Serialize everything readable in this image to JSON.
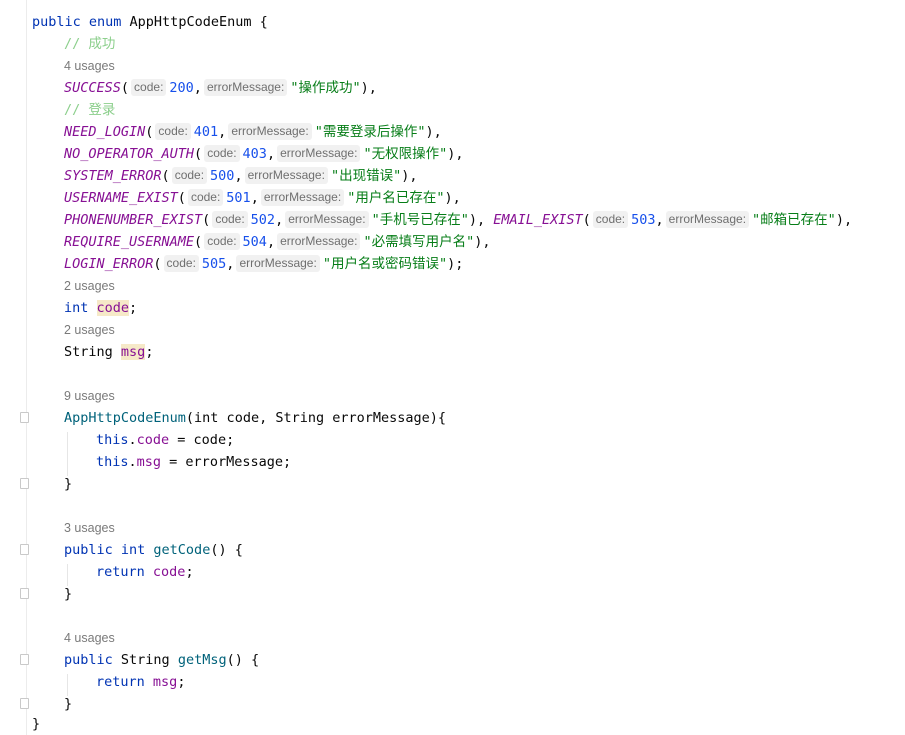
{
  "code": {
    "l1": {
      "kw": "public enum",
      "name": "AppHttpCodeEnum",
      "brace": " {"
    },
    "c_success": "// 成功",
    "u_success": "4 usages",
    "success": {
      "name": "SUCCESS",
      "code": "200",
      "msg": "\"操作成功\""
    },
    "c_login": "// 登录",
    "need_login": {
      "name": "NEED_LOGIN",
      "code": "401",
      "msg": "\"需要登录后操作\""
    },
    "no_operator_auth": {
      "name": "NO_OPERATOR_AUTH",
      "code": "403",
      "msg": "\"无权限操作\""
    },
    "system_error": {
      "name": "SYSTEM_ERROR",
      "code": "500",
      "msg": "\"出现错误\""
    },
    "username_exist": {
      "name": "USERNAME_EXIST",
      "code": "501",
      "msg": "\"用户名已存在\""
    },
    "phonenumber_exist": {
      "name": "PHONENUMBER_EXIST",
      "code": "502",
      "msg": "\"手机号已存在\""
    },
    "email_exist": {
      "name": "EMAIL_EXIST",
      "code": "503",
      "msg": "\"邮箱已存在\""
    },
    "require_username": {
      "name": "REQUIRE_USERNAME",
      "code": "504",
      "msg": "\"必需填写用户名\""
    },
    "login_error": {
      "name": "LOGIN_ERROR",
      "code": "505",
      "msg": "\"用户名或密码错误\""
    },
    "hint_code": "code:",
    "hint_msg": "errorMessage:",
    "u_code": "2 usages",
    "field_code": {
      "type": "int",
      "name": "code"
    },
    "u_msg": "2 usages",
    "field_msg": {
      "type": "String",
      "name": "msg"
    },
    "u_ctor": "9 usages",
    "ctor": {
      "name": "AppHttpCodeEnum",
      "params": "(int code, String errorMessage){"
    },
    "ctor_body1": {
      "kw": "this",
      "field": "code",
      "rest": " = code;"
    },
    "ctor_body2": {
      "kw": "this",
      "field": "msg",
      "rest": " = errorMessage;"
    },
    "close": "}",
    "u_getcode": "3 usages",
    "getcode": {
      "kw": "public int",
      "name": "getCode",
      "rest": "() {"
    },
    "getcode_body": {
      "kw": "return",
      "field": "code",
      "rest": ";"
    },
    "u_getmsg": "4 usages",
    "getmsg": {
      "kw": "public",
      "type": " String ",
      "name": "getMsg",
      "rest": "() {"
    },
    "getmsg_body": {
      "kw": "return",
      "field": "msg",
      "rest": ";"
    }
  },
  "colors": {
    "keyword": "#0033b3",
    "enum_constant": "#871094",
    "number": "#1750eb",
    "string": "#067d17",
    "comment": "#8ccf8c",
    "method": "#00627a",
    "usage_hint": "#7a7a7a"
  }
}
